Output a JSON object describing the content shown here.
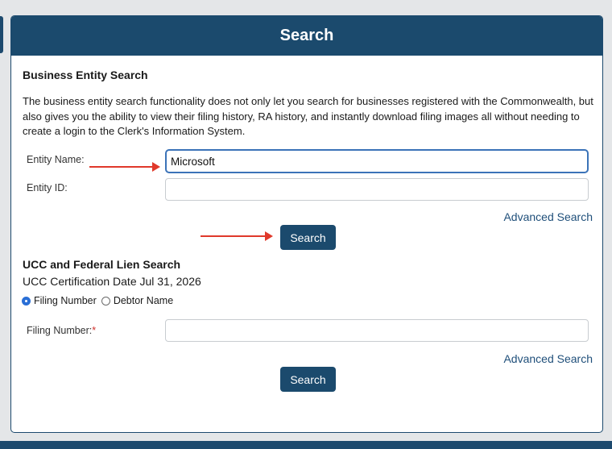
{
  "header": {
    "title": "Search"
  },
  "business": {
    "title": "Business Entity Search",
    "description": "The business entity search functionality does not only let you search for businesses registered with the Commonwealth, but also gives you the ability to view their filing history, RA history, and instantly download filing images all without needing to create a login to the Clerk's Information System.",
    "entity_name_label": "Entity Name:",
    "entity_name_value": "Microsoft",
    "entity_id_label": "Entity ID:",
    "entity_id_value": "",
    "advanced_link": "Advanced Search",
    "search_button": "Search"
  },
  "ucc": {
    "title": "UCC and Federal Lien Search",
    "certification": "UCC Certification Date Jul 31, 2026",
    "radio_filing_number": "Filing Number",
    "radio_debtor_name": "Debtor Name",
    "selected_radio": "Filing Number",
    "filing_number_label": "Filing Number:",
    "required_marker": "*",
    "filing_number_value": "",
    "advanced_link": "Advanced Search",
    "search_button": "Search"
  },
  "colors": {
    "header_bg": "#1b4a6d",
    "link": "#1f4f7a",
    "arrow": "#e0392b",
    "focus_border": "#3b73b8"
  }
}
